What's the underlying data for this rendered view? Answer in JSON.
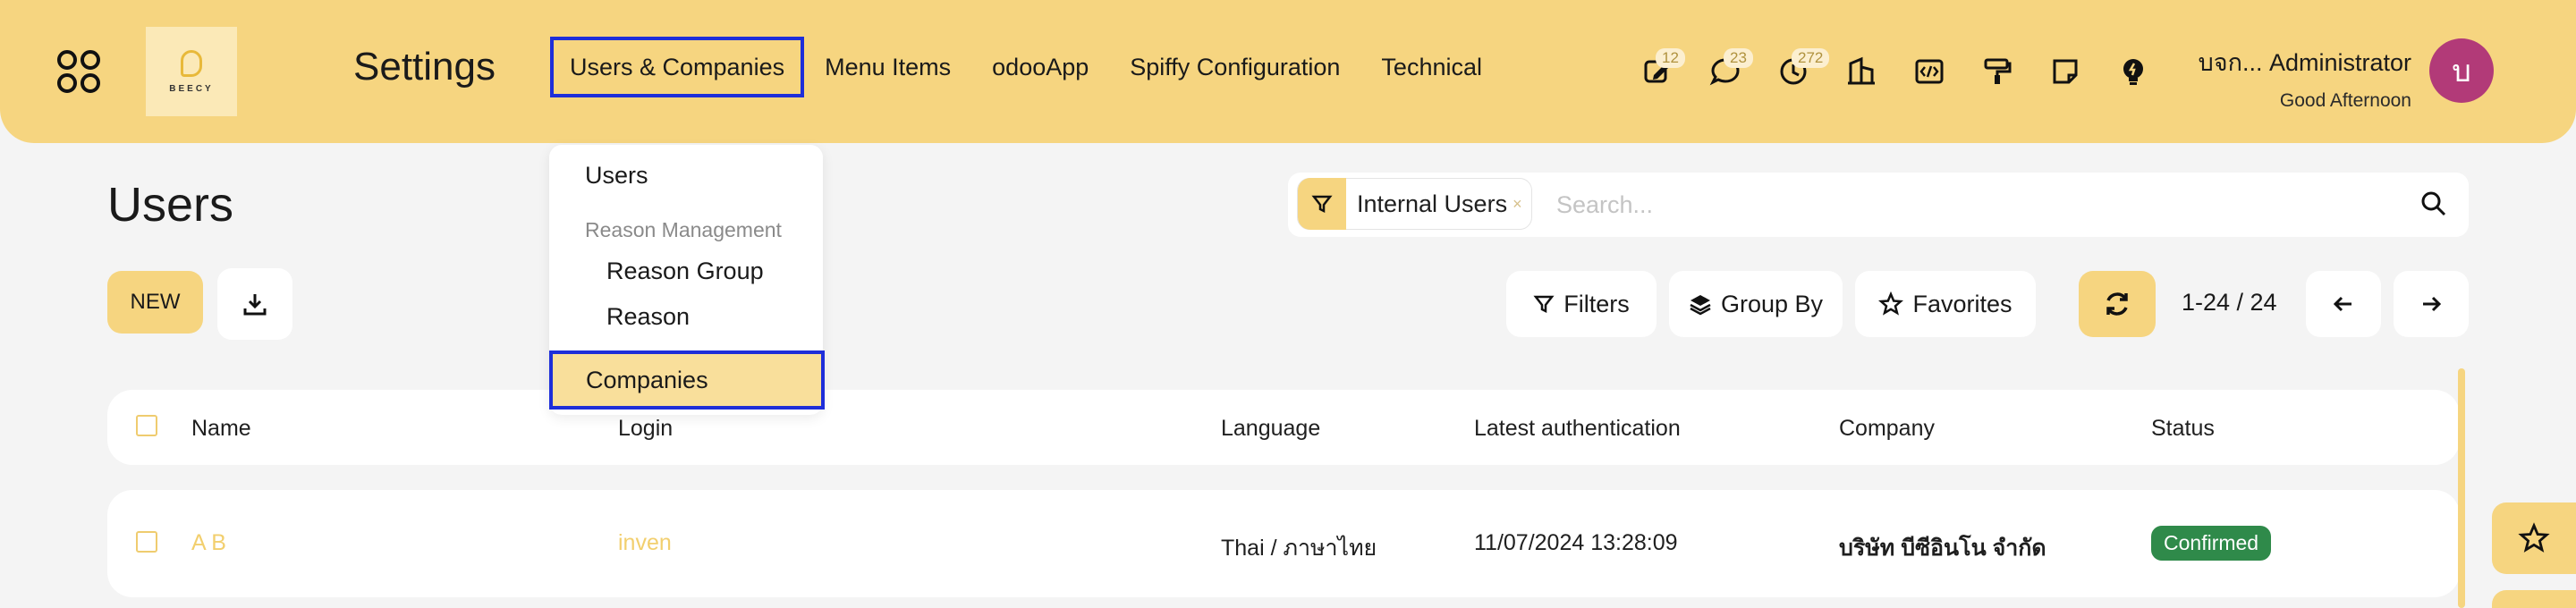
{
  "navbar": {
    "app_title": "Settings",
    "logo_text": "BEECY",
    "menu": [
      "Users & Companies",
      "Menu Items",
      "odooApp",
      "Spiffy Configuration",
      "Technical"
    ],
    "active_menu": "Users & Companies",
    "icons": [
      {
        "name": "activity-edit-icon",
        "badge": "12"
      },
      {
        "name": "chat-icon",
        "badge": "23"
      },
      {
        "name": "clock-icon",
        "badge": "272"
      },
      {
        "name": "company-building-icon",
        "badge": ""
      },
      {
        "name": "code-icon",
        "badge": ""
      },
      {
        "name": "paint-roller-icon",
        "badge": ""
      },
      {
        "name": "note-icon",
        "badge": ""
      },
      {
        "name": "bulb-icon",
        "badge": ""
      }
    ],
    "user_name": "บจก... Administrator",
    "greeting": "Good Afternoon",
    "avatar_letter": "บ",
    "avatar_color": "#b23a78"
  },
  "dropdown": {
    "users": "Users",
    "section_header": "Reason Management",
    "reason_group": "Reason Group",
    "reason": "Reason",
    "companies": "Companies"
  },
  "control_panel": {
    "title": "Users",
    "new_label": "NEW",
    "facet_label": "Internal Users",
    "facet_remove": "×",
    "search_placeholder": "Search...",
    "filters_label": "Filters",
    "groupby_label": "Group By",
    "favorites_label": "Favorites",
    "pager": "1-24 / 24"
  },
  "list": {
    "columns": [
      "Name",
      "Login",
      "Language",
      "Latest authentication",
      "Company",
      "Status"
    ],
    "rows": [
      {
        "name": "A B",
        "login": "inven",
        "language": "Thai / ภาษาไทย",
        "latest_auth": "11/07/2024 13:28:09",
        "company": "บริษัท บีซีอินโน จำกัด",
        "status": "Confirmed"
      }
    ]
  },
  "colors": {
    "accent": "#f6d580",
    "link": "#f2cf6e",
    "status_confirmed": "#2f8a4a",
    "focus_outline": "#1e2ed9"
  }
}
